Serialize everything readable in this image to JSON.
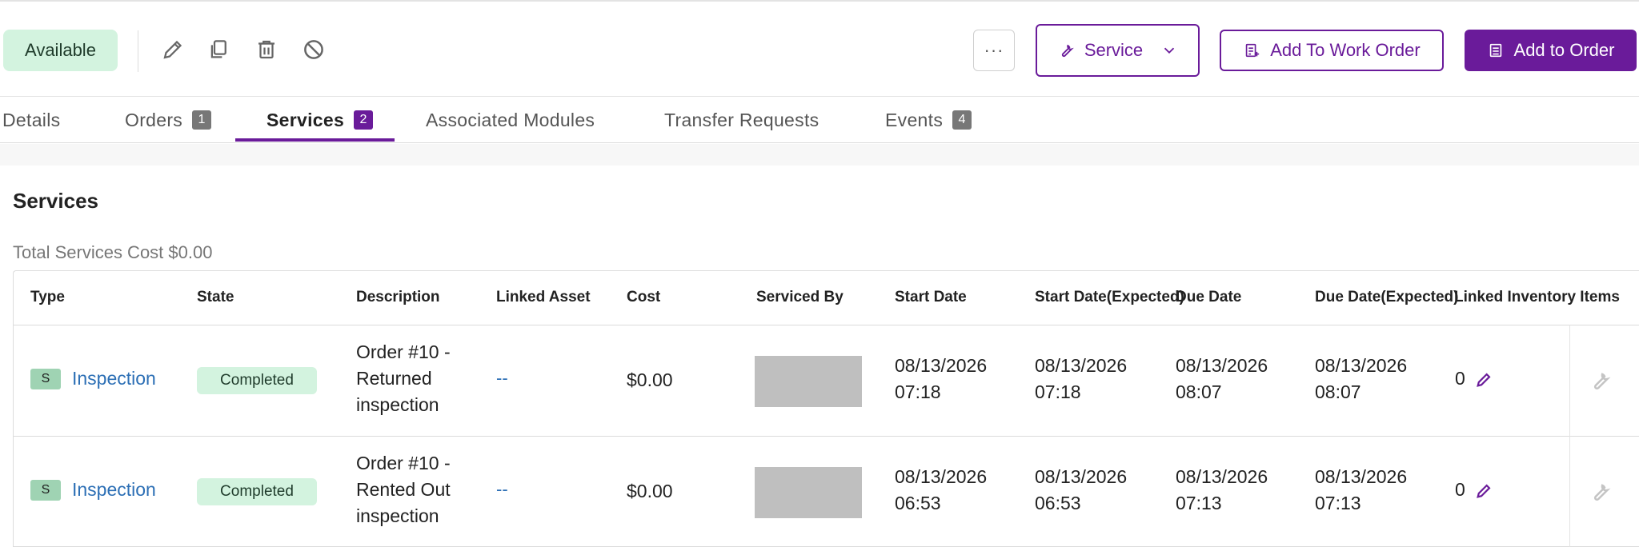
{
  "toolbar": {
    "status": "Available",
    "more_label": "···",
    "service_label": "Service",
    "add_to_work_order_label": "Add To Work Order",
    "add_to_order_label": "Add to Order",
    "accent_color": "#6a1b9a",
    "status_color": "#d3f3df",
    "icons": [
      "pencil-icon",
      "copy-icon",
      "trash-icon",
      "block-icon"
    ]
  },
  "tabs": [
    {
      "label": "Details",
      "count": null,
      "active": false
    },
    {
      "label": "Orders",
      "count": "1",
      "active": false
    },
    {
      "label": "Services",
      "count": "2",
      "active": true
    },
    {
      "label": "Associated Modules",
      "count": null,
      "active": false
    },
    {
      "label": "Transfer Requests",
      "count": null,
      "active": false
    },
    {
      "label": "Events",
      "count": "4",
      "active": false
    }
  ],
  "services": {
    "title": "Services",
    "total_cost": "Total Services Cost $0.00",
    "columns": [
      "Type",
      "State",
      "Description",
      "Linked Asset",
      "Cost",
      "Serviced By",
      "Start Date",
      "Start Date(Expected)",
      "Due Date",
      "Due Date(Expected)",
      "Linked Inventory Items"
    ],
    "rows": [
      {
        "type_badge": "S",
        "type": "Inspection",
        "state": "Completed",
        "description": [
          "Order #10 -",
          "Returned",
          "inspection"
        ],
        "linked_asset": "--",
        "cost": "$0.00",
        "start_date": [
          "08/13/2026",
          "07:18"
        ],
        "start_date_expected": [
          "08/13/2026",
          "07:18"
        ],
        "due_date": [
          "08/13/2026",
          "08:07"
        ],
        "due_date_expected": [
          "08/13/2026",
          "08:07"
        ],
        "linked_inventory": "0"
      },
      {
        "type_badge": "S",
        "type": "Inspection",
        "state": "Completed",
        "description": [
          "Order #10 -",
          "Rented Out",
          "inspection"
        ],
        "linked_asset": "--",
        "cost": "$0.00",
        "start_date": [
          "08/13/2026",
          "06:53"
        ],
        "start_date_expected": [
          "08/13/2026",
          "06:53"
        ],
        "due_date": [
          "08/13/2026",
          "07:13"
        ],
        "due_date_expected": [
          "08/13/2026",
          "07:13"
        ],
        "linked_inventory": "0"
      }
    ]
  }
}
